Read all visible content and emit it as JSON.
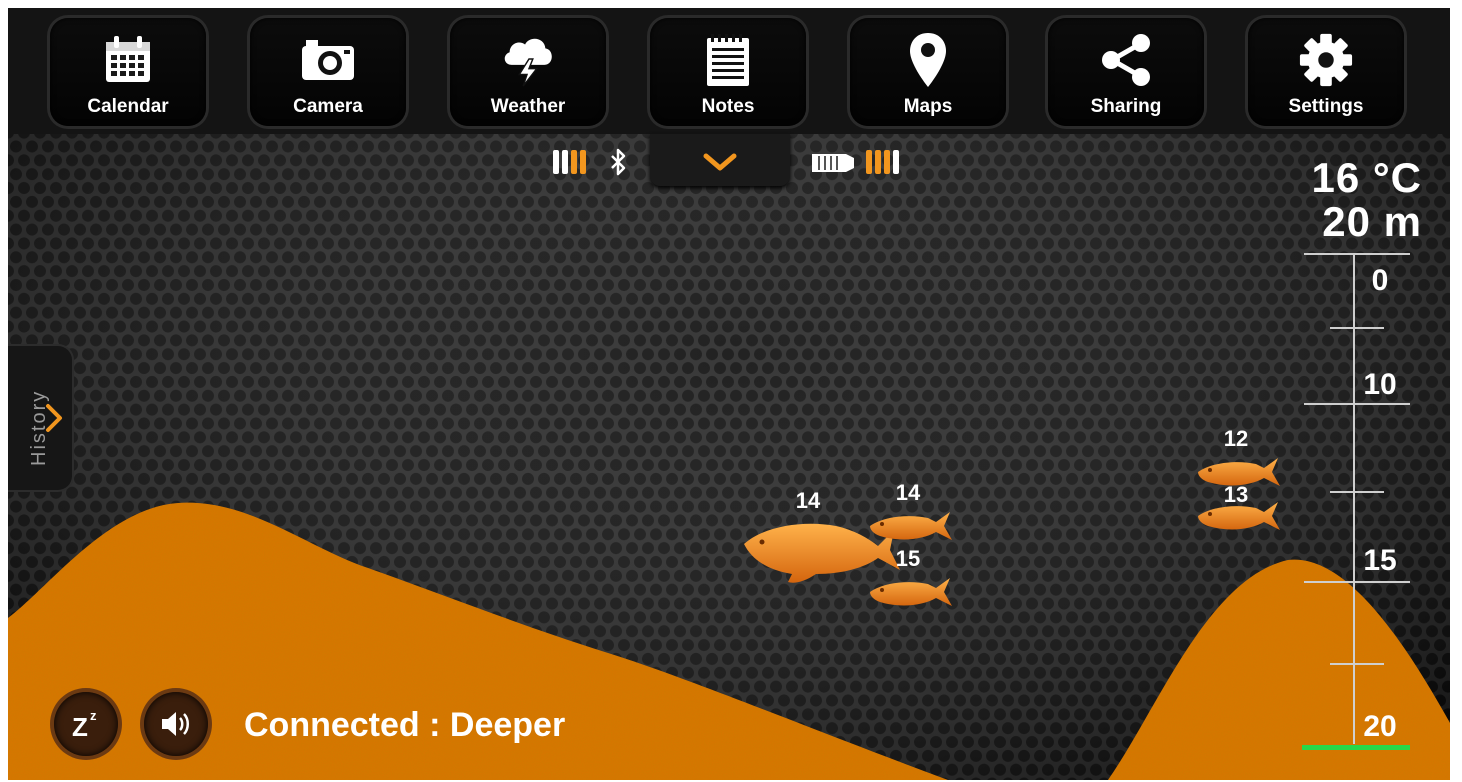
{
  "toolbar": {
    "items": [
      {
        "label": "Calendar",
        "icon": "calendar-icon"
      },
      {
        "label": "Camera",
        "icon": "camera-icon"
      },
      {
        "label": "Weather",
        "icon": "weather-icon"
      },
      {
        "label": "Notes",
        "icon": "notes-icon"
      },
      {
        "label": "Maps",
        "icon": "map-pin-icon"
      },
      {
        "label": "Sharing",
        "icon": "share-icon"
      },
      {
        "label": "Settings",
        "icon": "gear-icon"
      }
    ]
  },
  "status": {
    "phone_battery_icon": "battery-icon",
    "bluetooth_icon": "bluetooth-icon",
    "dropdown_icon": "chevron-down-icon",
    "sensor_icon": "sensor-icon",
    "sensor_battery_icon": "battery-icon"
  },
  "history": {
    "label": "History",
    "icon": "chevron-right-icon"
  },
  "readout": {
    "temperature": "16 °C",
    "depth": "20 m"
  },
  "depth_scale": {
    "ticks": [
      "0",
      "10",
      "15",
      "20"
    ]
  },
  "fish": [
    {
      "label": "14",
      "size": "large"
    },
    {
      "label": "14",
      "size": "small"
    },
    {
      "label": "15",
      "size": "small"
    },
    {
      "label": "12",
      "size": "small"
    },
    {
      "label": "13",
      "size": "small"
    }
  ],
  "bottom": {
    "sleep_icon": "sleep-icon",
    "sound_icon": "speaker-icon",
    "connection_status": "Connected : Deeper"
  },
  "colors": {
    "accent": "#f2961e",
    "bottom": "#d9730f",
    "background": "#1b1b1b",
    "depth_marker": "#27d84a"
  }
}
